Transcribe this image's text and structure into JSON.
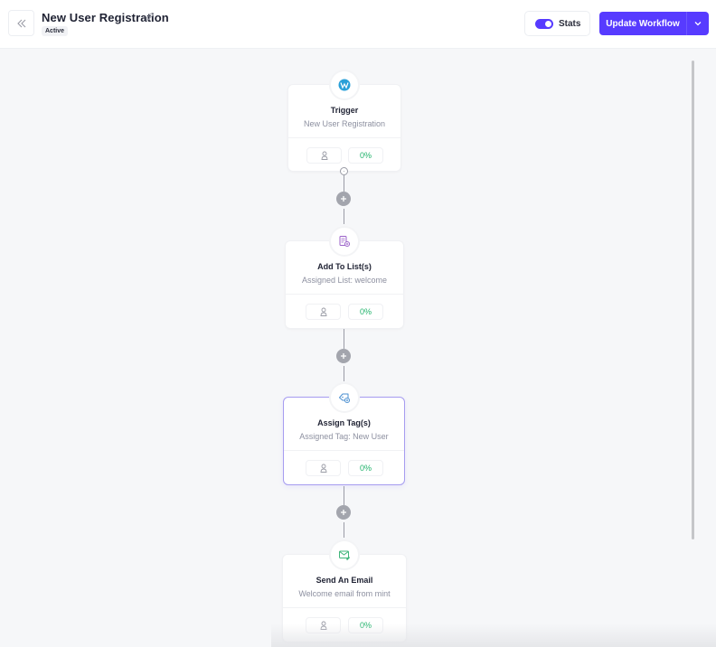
{
  "header": {
    "title": "New User Registration",
    "status": "Active",
    "stats_label": "Stats",
    "stats_enabled": true,
    "update_label": "Update Workflow",
    "accent_color": "#573bff"
  },
  "icons": {
    "back": "double-chevron-left-icon",
    "edit": "pencil-icon",
    "dropdown": "chevron-down-icon",
    "add": "plus-icon",
    "user": "user-icon"
  },
  "steps": [
    {
      "type": "trigger",
      "icon": "wordpress-icon",
      "title": "Trigger",
      "subtitle": "New User Registration",
      "user_count": "",
      "percent": "0%"
    },
    {
      "type": "action",
      "icon": "add-list-icon",
      "title": "Add To List(s)",
      "subtitle": "Assigned List: welcome",
      "user_count": "",
      "percent": "0%"
    },
    {
      "type": "action",
      "icon": "tag-icon",
      "title": "Assign Tag(s)",
      "subtitle": "Assigned Tag: New User",
      "user_count": "",
      "percent": "0%",
      "selected": true
    },
    {
      "type": "action",
      "icon": "email-icon",
      "title": "Send An Email",
      "subtitle": "Welcome email from mint",
      "user_count": "",
      "percent": "0%"
    }
  ]
}
